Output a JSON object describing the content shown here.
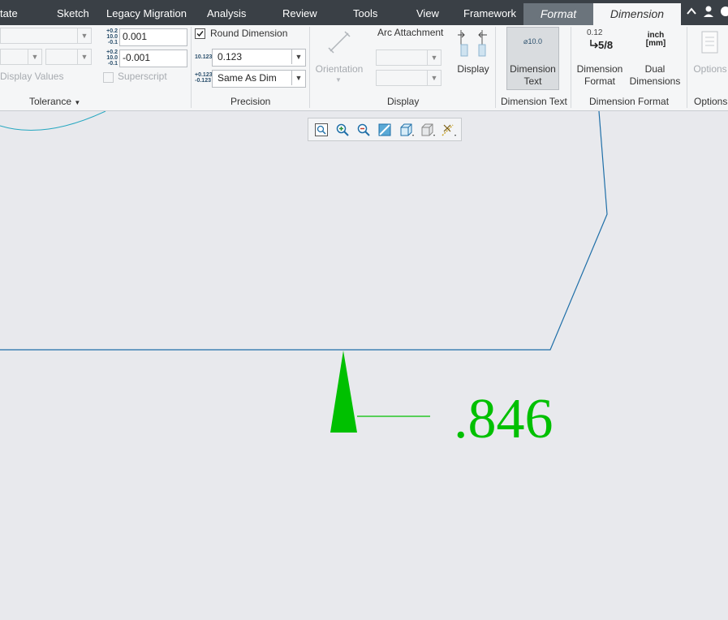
{
  "menubar": {
    "items": [
      "tate",
      "Sketch",
      "Legacy Migration",
      "Analysis",
      "Review",
      "Tools",
      "View",
      "Framework"
    ],
    "contextual_tabs": {
      "format": "Format",
      "dimension": "Dimension"
    }
  },
  "ribbon": {
    "tolerance": {
      "upper_icon_top": "+0.2",
      "upper_icon_bottom": "10.0",
      "upper_icon_sub": "-0.1",
      "upper_value": "0.001",
      "lower_value": "-0.001",
      "display_values_label": "Display Values",
      "superscript_label": "Superscript",
      "group_label": "Tolerance"
    },
    "precision": {
      "round_dimension_label": "Round Dimension",
      "round_dimension_checked": true,
      "decimal_icon": "10.123",
      "decimal_value": "0.123",
      "tol_icon_top": "+0.123",
      "tol_icon_bottom": "-0.123",
      "tol_value": "Same As Dim",
      "group_label": "Precision"
    },
    "display": {
      "orientation_label": "Orientation",
      "arc_attachment_label": "Arc Attachment",
      "display_button_label": "Display",
      "group_label": "Display"
    },
    "dimension_text": {
      "button_icon_text": "⌀10.0",
      "button_label_line1": "Dimension",
      "button_label_line2": "Text",
      "group_label": "Dimension Text"
    },
    "dimension_format": {
      "format_icon_top": "0.12",
      "format_icon_bottom": "5/8",
      "format_label_line1": "Dimension",
      "format_label_line2": "Format",
      "dual_icon_top": "inch",
      "dual_icon_bottom": "[mm]",
      "dual_label_line1": "Dual",
      "dual_label_line2": "Dimensions",
      "group_label": "Dimension Format"
    },
    "options": {
      "button_label": "Options",
      "group_label": "Options"
    }
  },
  "canvas": {
    "dimension_value": ".846",
    "colors": {
      "background": "#e8e9ed",
      "geometry_line": "#1f6fa8",
      "arc_line": "#25a7c0",
      "dimension_green": "#00c000"
    }
  },
  "view_toolbar": {
    "icons": [
      "refit-icon",
      "zoom-in-icon",
      "zoom-out-icon",
      "repaint-icon",
      "saved-orientations-icon",
      "display-style-icon",
      "annotation-display-icon"
    ]
  }
}
